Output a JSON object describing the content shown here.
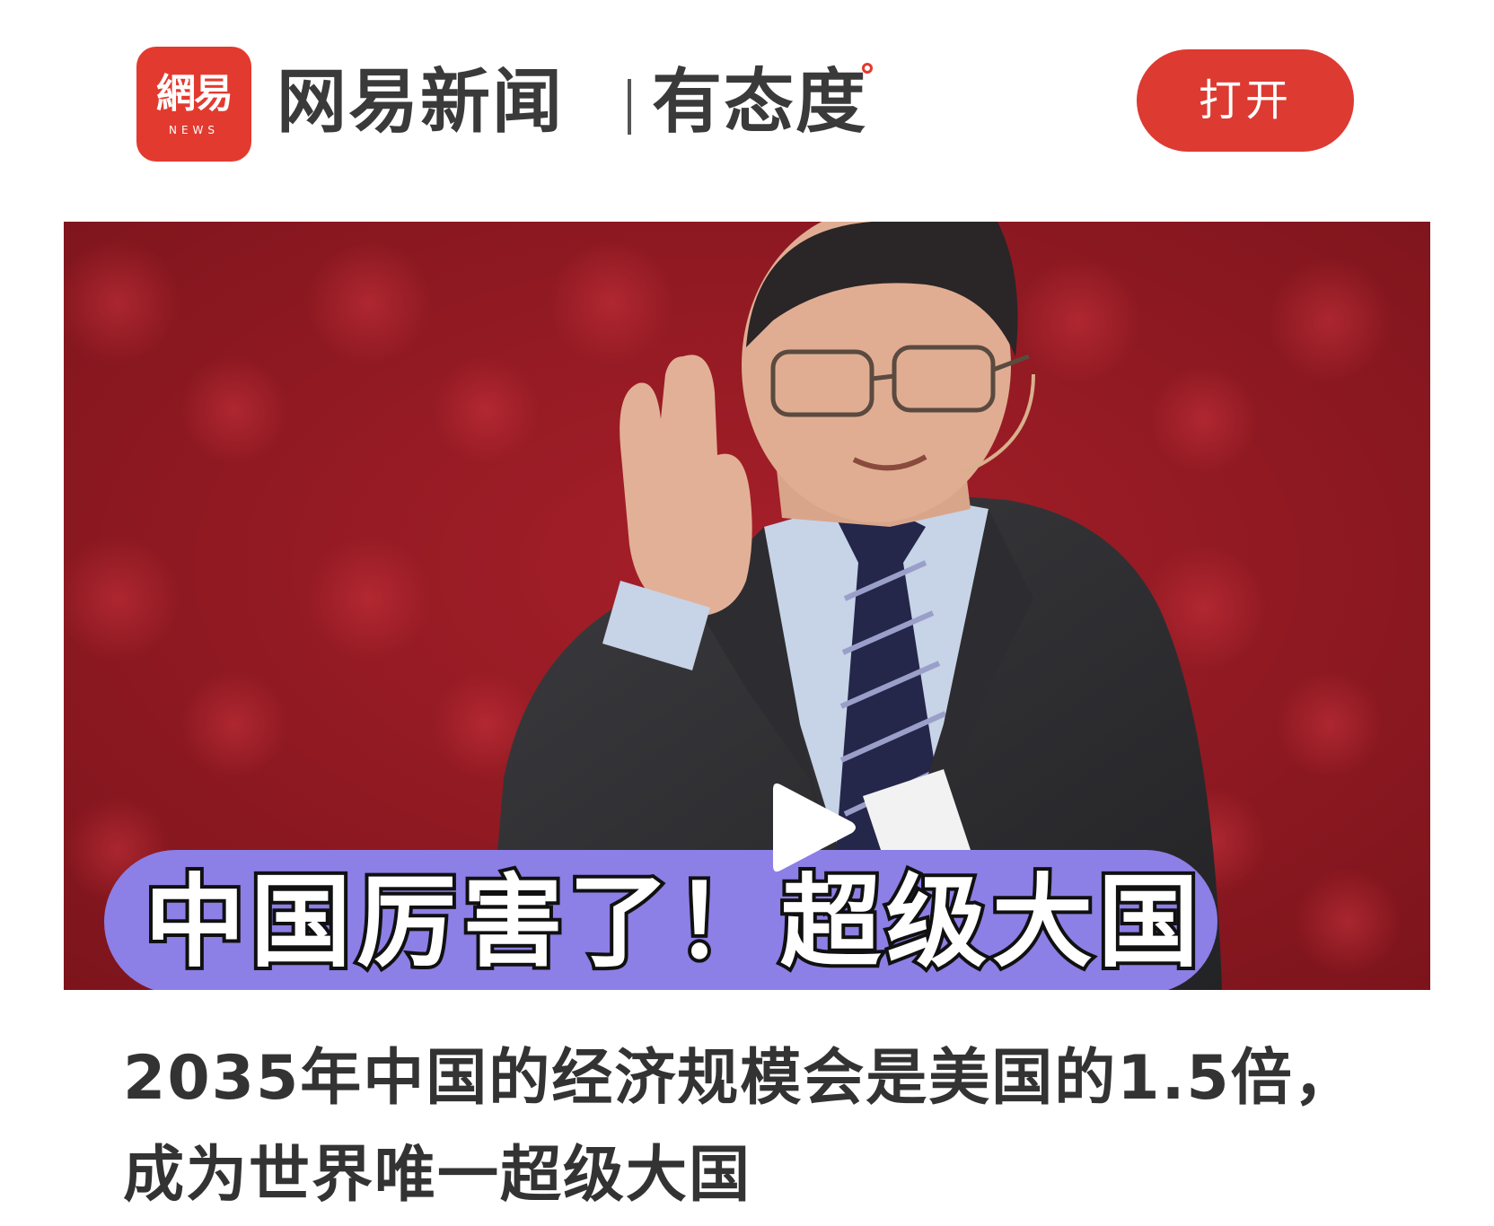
{
  "header": {
    "logo_glyph": "網易",
    "logo_sub": "NEWS",
    "brand_name": "网易新闻",
    "brand_slogan": "有态度",
    "open_label": "打开",
    "brand_color": "#e33a2f"
  },
  "video": {
    "subtitle": "中国厉害了！超级大国",
    "play_icon": "play-icon",
    "background_color": "#8e1a22",
    "subtitle_pill_color": "#8c7fe6"
  },
  "article": {
    "headline": "2035年中国的经济规模会是美国的1.5倍，成为世界唯一超级大国"
  }
}
